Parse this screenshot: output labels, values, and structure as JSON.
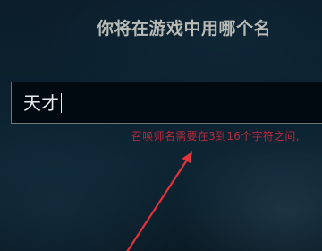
{
  "dialog": {
    "heading": "你将在游戏中用哪个名",
    "name_input": {
      "value": "天才"
    },
    "error_message": "召唤师名需要在3到16个字符之间,"
  },
  "annotation": {
    "arrow_color": "#e0333c"
  },
  "colors": {
    "heading_text": "#b9bbb7",
    "input_border": "#6e7474",
    "error_text": "#b8283c",
    "background": "#0c2230"
  }
}
